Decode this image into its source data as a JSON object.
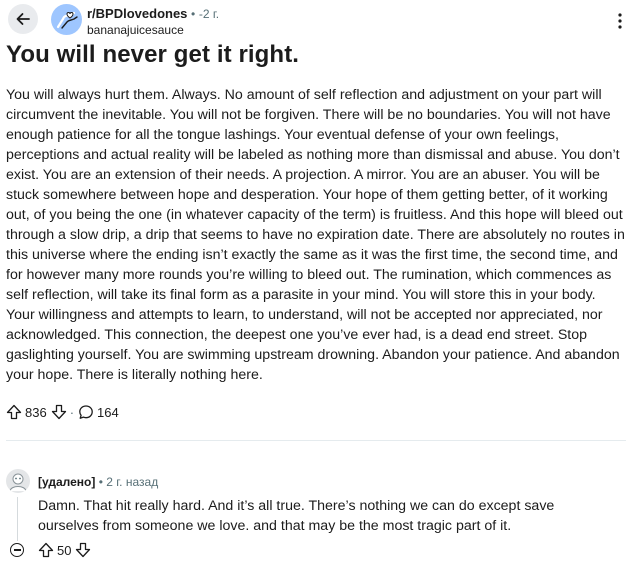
{
  "post": {
    "subreddit": "r/BPDlovedones",
    "separator": "•",
    "time": "-2 г.",
    "author": "bananajuicesauce",
    "title": "You will never get it right.",
    "body": "You will always hurt them. Always. No amount of self reflection and adjustment on your part will circumvent the inevitable. You will not be forgiven. There will be no boundaries. You will not have enough patience for all the tongue lashings. Your eventual defense of your own feelings, perceptions and actual reality will be labeled as nothing more than dismissal and abuse. You don’t exist. You are an extension of their needs. A projection. A mirror. You are an abuser. You will be stuck somewhere between hope and desperation. Your hope of them getting better, of it working out, of you being the one (in whatever capacity of the term) is fruitless. And this hope will bleed out through a slow drip, a drip that seems to have no expiration date. There are absolutely no routes in this universe where the ending isn’t exactly the same as it was the first time, the second time, and for however many more rounds you’re willing to bleed out. The rumination, which commences as self reflection, will take its final form as a parasite in your mind. You will store this in your body. Your willingness and attempts to learn, to understand, will not be accepted nor appreciated, nor acknowledged. This connection, the deepest one you’ve ever had, is a dead end street. Stop gaslighting yourself. You are swimming upstream drowning. Abandon your patience. And abandon your hope. There is literally nothing here.",
    "upvotes": "836",
    "vote_separator": "·",
    "comments": "164"
  },
  "comment": {
    "author": "[удалено]",
    "separator": "•",
    "time": "2 г. назад",
    "body": "Damn. That hit really hard. And it’s all true. There’s nothing we can do except save ourselves from someone we love. and that may be the most tragic part of it.",
    "upvotes": "50"
  },
  "icons": {
    "back": "arrow-left-icon",
    "more": "kebab-vertical-icon",
    "upvote": "arrow-up-icon",
    "downvote": "arrow-down-icon",
    "comment": "speech-bubble-icon",
    "collapse": "minus-circle-icon"
  },
  "colors": {
    "text": "#1c1c1c",
    "muted": "#576f76",
    "avatar_bg": "#9ec6ff",
    "button_bg": "#e9ebee"
  }
}
